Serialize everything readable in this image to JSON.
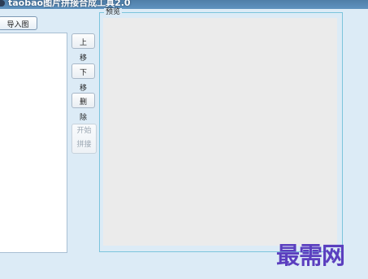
{
  "window": {
    "title": "taobao图片拼接合成工具2.0"
  },
  "toolbar": {
    "import_label": "导入图片"
  },
  "actions": {
    "move_up": "上移",
    "move_down": "下移",
    "delete": "删除",
    "start_line1": "开始",
    "start_line2": "拼接"
  },
  "preview": {
    "label": "预览"
  },
  "watermark": {
    "text": "最需网"
  }
}
